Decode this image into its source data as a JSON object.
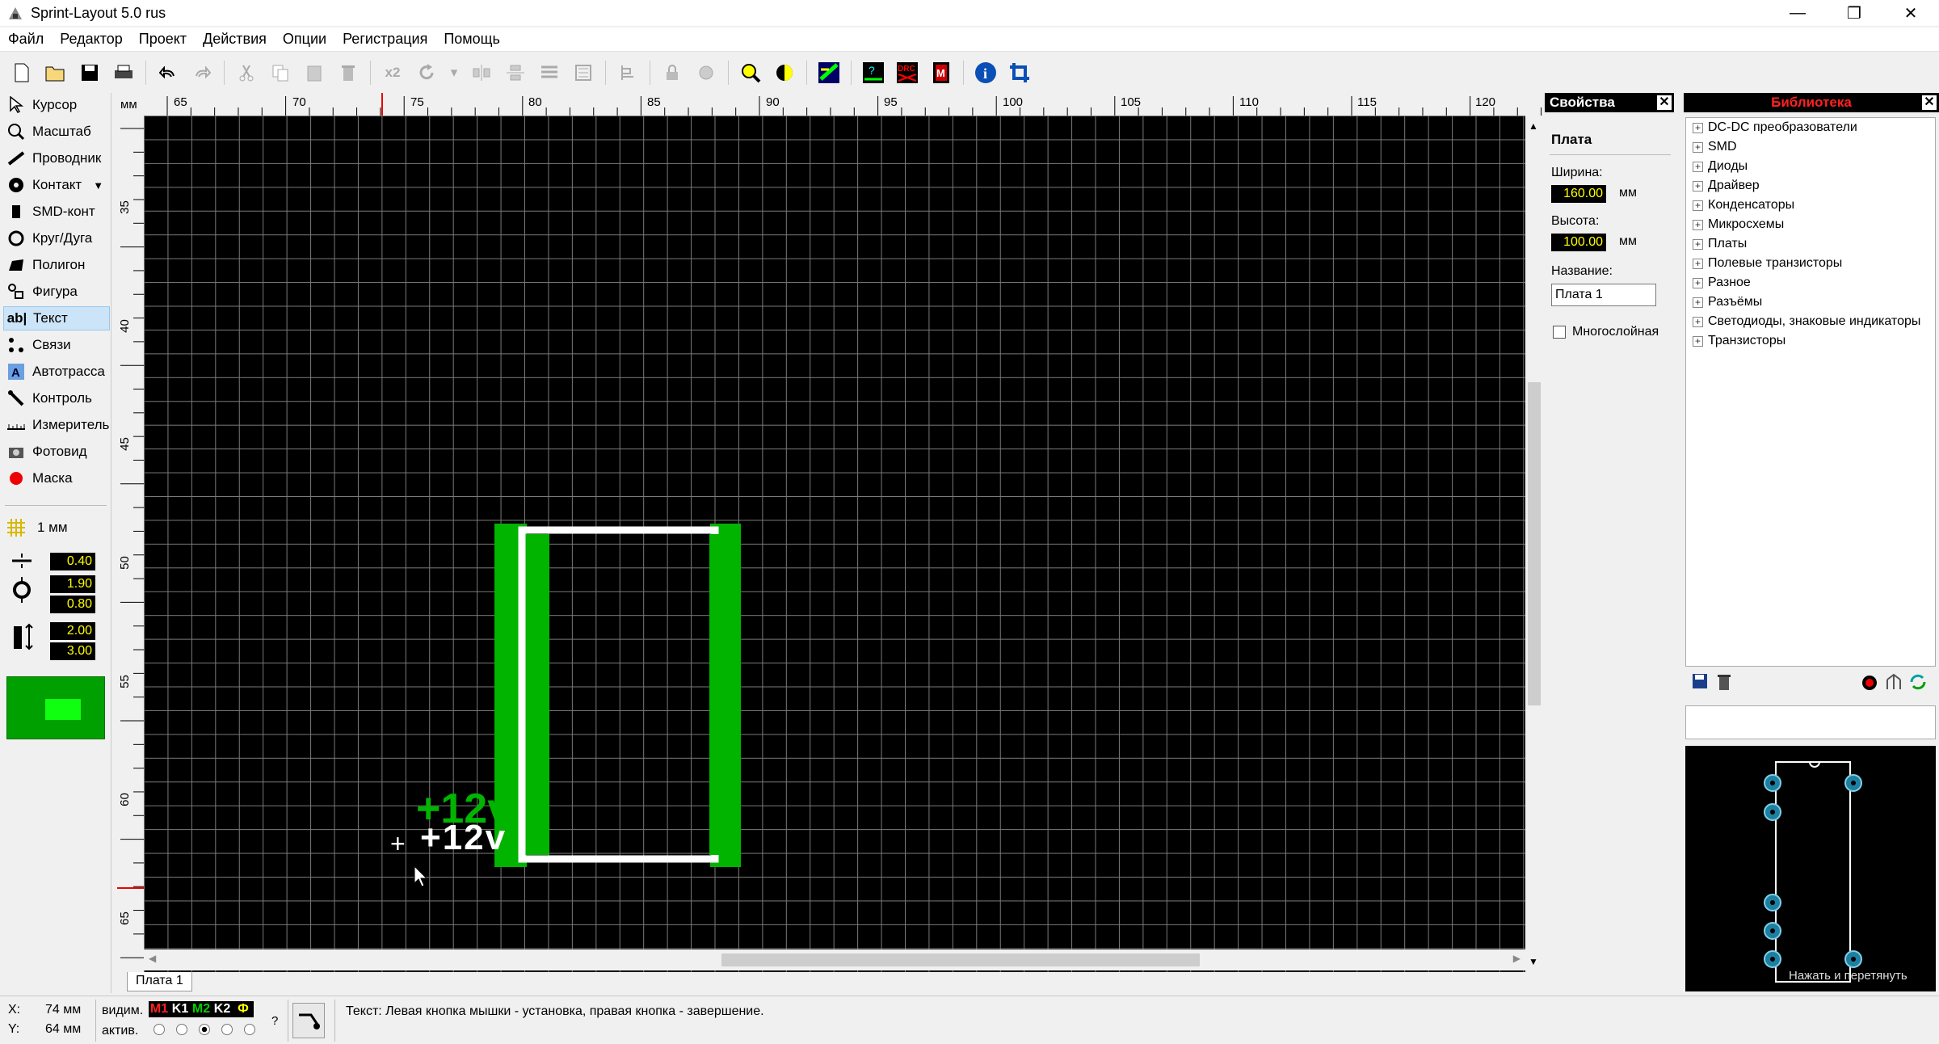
{
  "window": {
    "title": "Sprint-Layout 5.0 rus",
    "minimize": "—",
    "maximize": "❐",
    "close": "✕"
  },
  "menu": [
    "Файл",
    "Редактор",
    "Проект",
    "Действия",
    "Опции",
    "Регистрация",
    "Помощь"
  ],
  "toolbar": {
    "x2_label": "x2"
  },
  "tools": [
    {
      "label": "Курсор",
      "icon": "cursor-icon"
    },
    {
      "label": "Масштаб",
      "icon": "zoom-icon"
    },
    {
      "label": "Проводник",
      "icon": "track-icon"
    },
    {
      "label": "Контакт",
      "icon": "pad-icon"
    },
    {
      "label": "SMD-конт",
      "icon": "smd-pad-icon"
    },
    {
      "label": "Круг/Дуга",
      "icon": "circle-arc-icon"
    },
    {
      "label": "Полигон",
      "icon": "polygon-icon"
    },
    {
      "label": "Фигура",
      "icon": "shape-icon"
    },
    {
      "label": "Текст",
      "icon": "text-icon"
    },
    {
      "label": "Связи",
      "icon": "connections-icon"
    },
    {
      "label": "Автотрасса",
      "icon": "autoroute-icon"
    },
    {
      "label": "Контроль",
      "icon": "test-icon"
    },
    {
      "label": "Измеритель",
      "icon": "measure-icon"
    },
    {
      "label": "Фотовид",
      "icon": "photoview-icon"
    },
    {
      "label": "Маска",
      "icon": "mask-icon"
    }
  ],
  "grid": {
    "label": "1 мм"
  },
  "params": {
    "track_width": "0.40",
    "pad_outer": "1.90",
    "pad_inner": "0.80",
    "smd_w": "2.00",
    "smd_h": "3.00"
  },
  "ruler": {
    "unit": "мм",
    "top_ticks": [
      "65",
      "70",
      "75",
      "80",
      "85",
      "90",
      "95",
      "100",
      "105",
      "110",
      "115",
      "120"
    ],
    "left_ticks": [
      "35",
      "40",
      "45",
      "50",
      "55",
      "60",
      "65"
    ]
  },
  "canvas": {
    "text_green": "+12v",
    "text_white": "+12v"
  },
  "sheet_tab": "Плата 1",
  "properties": {
    "title": "Свойства",
    "section": "Плата",
    "width_label": "Ширина:",
    "width_value": "160.00",
    "height_label": "Высота:",
    "height_value": "100.00",
    "unit": "мм",
    "name_label": "Название:",
    "name_value": "Плата 1",
    "multilayer_label": "Многослойная"
  },
  "library": {
    "title": "Библиотека",
    "items": [
      "DC-DC преобразователи",
      "SMD",
      "Диоды",
      "Драйвер",
      "Конденсаторы",
      "Микросхемы",
      "Платы",
      "Полевые транзисторы",
      "Разное",
      "Разъёмы",
      "Светодиоды, знаковые индикаторы",
      "Транзисторы"
    ],
    "hint": "Нажать и перетянуть"
  },
  "status": {
    "x_label": "X:",
    "x_value": "74 мм",
    "y_label": "Y:",
    "y_value": "64 мм",
    "visible_label": "видим.",
    "active_label": "актив.",
    "layers": [
      "M1",
      "K1",
      "M2",
      "K2",
      "Ф"
    ],
    "question": "?",
    "message": "Текст: Левая кнопка мышки - установка, правая кнопка - завершение."
  },
  "colors": {
    "copper_green": "#00b400",
    "silk_white": "#ffffff",
    "layer_m1": "#ff2020",
    "layer_m2": "#00c000",
    "layer_f": "#ffff00"
  }
}
